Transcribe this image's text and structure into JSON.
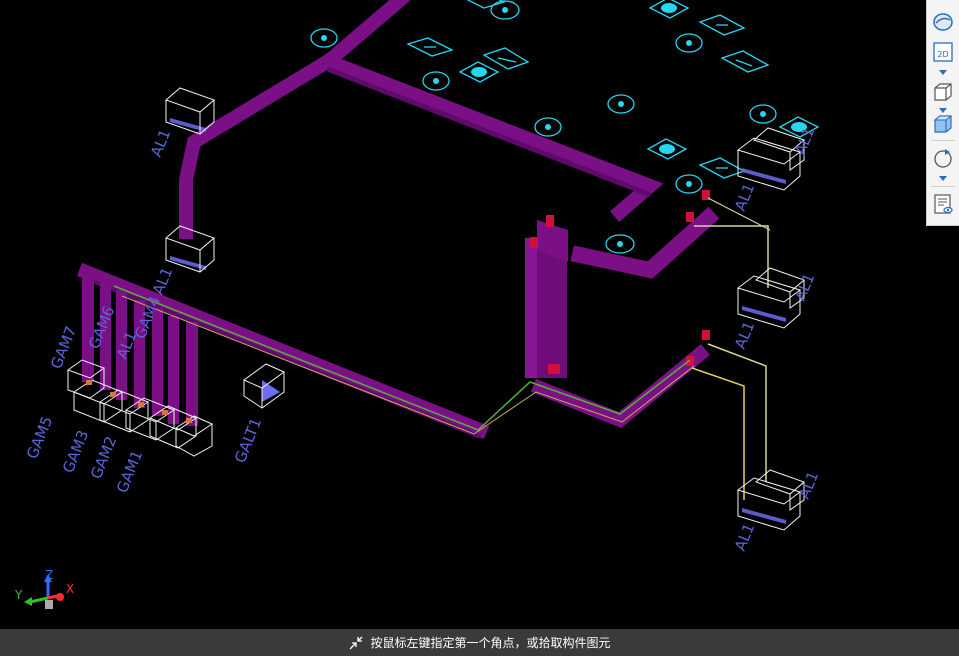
{
  "viewport": {
    "labels": {
      "al1_a": "AL1",
      "al1_b": "AL1",
      "al1_c": "AL1",
      "al1_d": "AL1",
      "al1_e": "AL1",
      "al1_f": "AL1",
      "al1_g": "AL1",
      "al1_h": "AL1",
      "al1_i": "AL1",
      "gam7": "GAM7",
      "gam6": "GAM6",
      "gam4": "GAM4",
      "gam5": "GAM5",
      "gam3": "GAM3",
      "gam2": "GAM2",
      "gam1": "GAM1",
      "galt1": "GALT1"
    }
  },
  "axis": {
    "x_label": "X",
    "y_label": "Y",
    "z_label": "Z"
  },
  "toolbar": {
    "view_2d_label": "2D"
  },
  "status": {
    "prompt": "按鼠标左键指定第一个角点，或拾取构件图元"
  },
  "colors": {
    "background": "#000000",
    "pipe": "#7a0f86",
    "pipe_joint": "#d0103a",
    "cad_symbol": "#27d6f0",
    "label_text": "#5a66d8",
    "wire_green": "#58b03a",
    "wire_yellow": "#e0d060",
    "statusbar": "#3a3a3a",
    "toolbar": "#f4f4f4",
    "toolbar_accent": "#2a6ebb"
  }
}
